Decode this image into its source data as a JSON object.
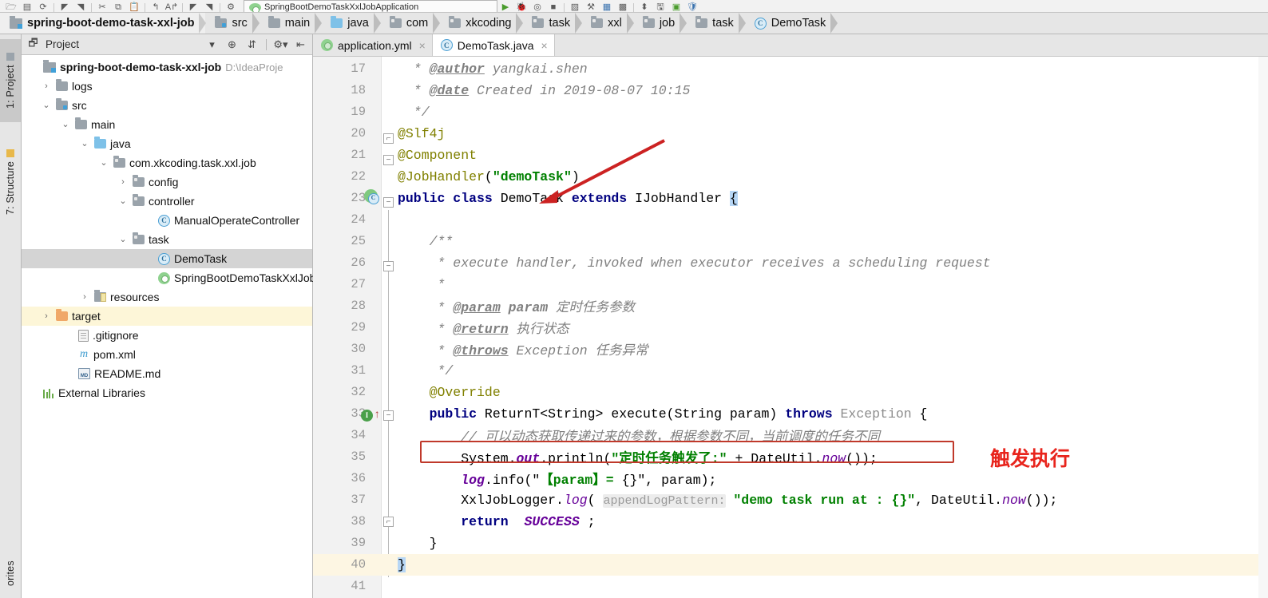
{
  "toolbar": {
    "run_config_name": "SpringBootDemoTaskXxlJobApplication",
    "icons": [
      "open-folder-icon",
      "save-all-icon",
      "sync-icon",
      "back-icon",
      "forward-icon",
      "cut-icon",
      "copy-icon",
      "paste-icon",
      "undo-icon",
      "redo-icon",
      "find-prev-icon",
      "find-next-icon",
      "settings-icon",
      "run-icon",
      "debug-icon",
      "coverage-icon",
      "stop-icon",
      "profile-icon",
      "build-icon",
      "struct-icon",
      "search-icon",
      "vcs-icon",
      "plugin-icon",
      "help-icon"
    ]
  },
  "breadcrumb": {
    "items": [
      {
        "label": "spring-boot-demo-task-xxl-job",
        "icon": "project-root-icon",
        "type": "project"
      },
      {
        "label": "src",
        "icon": "source-folder-icon",
        "type": "src"
      },
      {
        "label": "main",
        "icon": "folder-icon",
        "type": "folder"
      },
      {
        "label": "java",
        "icon": "java-folder-icon",
        "type": "java"
      },
      {
        "label": "com",
        "icon": "package-icon",
        "type": "package"
      },
      {
        "label": "xkcoding",
        "icon": "package-icon",
        "type": "package"
      },
      {
        "label": "task",
        "icon": "package-icon",
        "type": "package"
      },
      {
        "label": "xxl",
        "icon": "package-icon",
        "type": "package"
      },
      {
        "label": "job",
        "icon": "package-icon",
        "type": "package"
      },
      {
        "label": "task",
        "icon": "package-icon",
        "type": "package"
      },
      {
        "label": "DemoTask",
        "icon": "class-icon",
        "type": "class"
      }
    ]
  },
  "tool_strip": {
    "items": [
      {
        "label": "1: Project",
        "selected": true,
        "icon": "project-tool-icon"
      },
      {
        "label": "7: Structure",
        "selected": false,
        "icon": "structure-tool-icon"
      }
    ],
    "bottom_label": "orites"
  },
  "project_panel": {
    "title": "Project",
    "header_icons": [
      "chevron-down-icon",
      "locate-icon",
      "collapse-all-icon",
      "gear-icon",
      "hide-icon"
    ],
    "tree": [
      {
        "indent": 0,
        "twist": "",
        "label": "spring-boot-demo-task-xxl-job",
        "suffix": "D:\\IdeaProje",
        "icon": "project-root-icon",
        "bold": true,
        "state": "none"
      },
      {
        "indent": 1,
        "twist": "›",
        "label": "logs",
        "suffix": "",
        "icon": "folder-icon",
        "bold": false,
        "state": "none"
      },
      {
        "indent": 1,
        "twist": "⌄",
        "label": "src",
        "suffix": "",
        "icon": "source-folder-icon",
        "bold": false,
        "state": "none"
      },
      {
        "indent": 2,
        "twist": "⌄",
        "label": "main",
        "suffix": "",
        "icon": "folder-icon",
        "bold": false,
        "state": "none"
      },
      {
        "indent": 3,
        "twist": "⌄",
        "label": "java",
        "suffix": "",
        "icon": "java-folder-icon",
        "bold": false,
        "state": "none"
      },
      {
        "indent": 4,
        "twist": "⌄",
        "label": "com.xkcoding.task.xxl.job",
        "suffix": "",
        "icon": "package-icon",
        "bold": false,
        "state": "none"
      },
      {
        "indent": 5,
        "twist": "›",
        "label": "config",
        "suffix": "",
        "icon": "package-icon",
        "bold": false,
        "state": "none"
      },
      {
        "indent": 5,
        "twist": "⌄",
        "label": "controller",
        "suffix": "",
        "icon": "package-icon",
        "bold": false,
        "state": "none"
      },
      {
        "indent": 6,
        "twist": "",
        "label": "ManualOperateController",
        "suffix": "",
        "icon": "class-icon",
        "bold": false,
        "state": "none"
      },
      {
        "indent": 5,
        "twist": "⌄",
        "label": "task",
        "suffix": "",
        "icon": "package-icon",
        "bold": false,
        "state": "none"
      },
      {
        "indent": 6,
        "twist": "",
        "label": "DemoTask",
        "suffix": "",
        "icon": "class-icon",
        "bold": false,
        "state": "selected"
      },
      {
        "indent": 6,
        "twist": "",
        "label": "SpringBootDemoTaskXxlJob",
        "suffix": "",
        "icon": "spring-class-icon",
        "bold": false,
        "state": "none"
      },
      {
        "indent": 3,
        "twist": "›",
        "label": "resources",
        "suffix": "",
        "icon": "resources-folder-icon",
        "bold": false,
        "state": "none"
      },
      {
        "indent": 1,
        "twist": "›",
        "label": "target",
        "suffix": "",
        "icon": "target-folder-icon",
        "bold": false,
        "state": "highlight"
      },
      {
        "indent": 2,
        "twist": "",
        "label": ".gitignore",
        "suffix": "",
        "icon": "file-icon",
        "bold": false,
        "state": "none"
      },
      {
        "indent": 2,
        "twist": "",
        "label": "pom.xml",
        "suffix": "",
        "icon": "maven-icon",
        "bold": false,
        "state": "none"
      },
      {
        "indent": 2,
        "twist": "",
        "label": "README.md",
        "suffix": "",
        "icon": "markdown-icon",
        "bold": false,
        "state": "none"
      },
      {
        "indent": 0,
        "twist": "",
        "label": "External Libraries",
        "suffix": "",
        "icon": "library-icon",
        "bold": false,
        "state": "none"
      }
    ]
  },
  "editor": {
    "tabs": [
      {
        "label": "application.yml",
        "icon": "yaml-spring-icon",
        "active": false,
        "close": "×"
      },
      {
        "label": "DemoTask.java",
        "icon": "class-icon",
        "active": true,
        "close": "×"
      }
    ],
    "first_line_number": 17,
    "lines": [
      {
        "n": 17,
        "text": " * @author yangkai.shen"
      },
      {
        "n": 18,
        "text": " * @date Created in 2019-08-07 10:15"
      },
      {
        "n": 19,
        "text": " */"
      },
      {
        "n": 20,
        "text": "@Slf4j"
      },
      {
        "n": 21,
        "text": "@Component"
      },
      {
        "n": 22,
        "text": "@JobHandler(\"demoTask\")"
      },
      {
        "n": 23,
        "text": "public class DemoTask extends IJobHandler {"
      },
      {
        "n": 24,
        "text": ""
      },
      {
        "n": 25,
        "text": "    /**"
      },
      {
        "n": 26,
        "text": "     * execute handler, invoked when executor receives a scheduling request"
      },
      {
        "n": 27,
        "text": "     *"
      },
      {
        "n": 28,
        "text": "     * @param param 定时任务参数"
      },
      {
        "n": 29,
        "text": "     * @return 执行状态"
      },
      {
        "n": 30,
        "text": "     * @throws Exception 任务异常"
      },
      {
        "n": 31,
        "text": "     */"
      },
      {
        "n": 32,
        "text": "    @Override"
      },
      {
        "n": 33,
        "text": "    public ReturnT<String> execute(String param) throws Exception {"
      },
      {
        "n": 34,
        "text": "        // 可以动态获取传递过来的参数，根据参数不同，当前调度的任务不同"
      },
      {
        "n": 35,
        "text": "        System.out.println(\"定时任务触发了:\" + DateUtil.now());"
      },
      {
        "n": 36,
        "text": "        log.info(\"【param】= {}\", param);"
      },
      {
        "n": 37,
        "text": "        XxlJobLogger.log( appendLogPattern: \"demo task run at : {}\", DateUtil.now());"
      },
      {
        "n": 38,
        "text": "        return  SUCCESS ;"
      },
      {
        "n": 39,
        "text": "    }"
      },
      {
        "n": 40,
        "text": "}"
      },
      {
        "n": 41,
        "text": ""
      }
    ],
    "gutter_markers": [
      {
        "line": 23,
        "icon": "run-class-gutter-icon"
      },
      {
        "line": 33,
        "icon": "override-method-gutter-icon"
      }
    ],
    "cursor_line": 40,
    "hint_label": "appendLogPattern:"
  },
  "annotations": {
    "arrow": {
      "name": "red-arrow-to-jobhandler",
      "color": "#cc2222"
    },
    "box": {
      "name": "red-highlight-box-println",
      "color": "#c0392b"
    },
    "text": "触发执行",
    "text_color": "#e8241c"
  },
  "colors": {
    "keyword": "#000080",
    "annotation": "#808000",
    "string": "#008000",
    "comment": "#808080",
    "field": "#660099",
    "accent_red": "#cc2222",
    "selection_blue": "#b6d6f5",
    "cursor_line": "#fdf6e3"
  }
}
